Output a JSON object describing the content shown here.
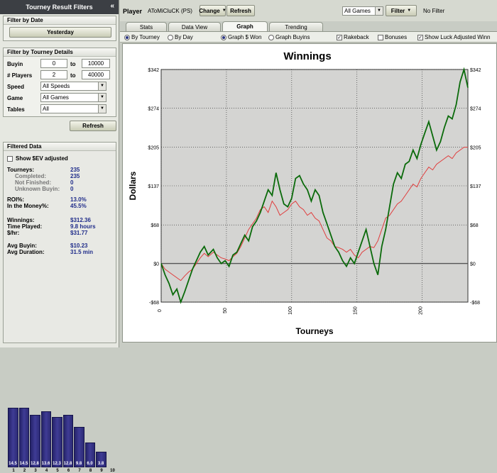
{
  "left": {
    "title": "Tourney Result Filters",
    "collapse_glyph": "«",
    "by_date": {
      "header": "Filter by Date",
      "button": "Yesterday"
    },
    "details": {
      "header": "Filter by Tourney Details",
      "buyin_label": "Buyin",
      "buyin_min": "0",
      "buyin_to": "to",
      "buyin_max": "10000",
      "players_label": "# Players",
      "players_min": "2",
      "players_to": "to",
      "players_max": "40000",
      "speed_label": "Speed",
      "speed_value": "All Speeds",
      "game_label": "Game",
      "game_value": "All Games",
      "tables_label": "Tables",
      "tables_value": "All"
    },
    "refresh": "Refresh",
    "filtered": {
      "header": "Filtered Data",
      "show_ev": "Show $EV adjusted",
      "stats": [
        {
          "label": "Tourneys:",
          "value": "235",
          "sub": false
        },
        {
          "label": "Completed:",
          "value": "235",
          "sub": true
        },
        {
          "label": "Not Finished:",
          "value": "0",
          "sub": true
        },
        {
          "label": "Unknown Buyin:",
          "value": "0",
          "sub": true
        },
        {
          "label": "ROI%:",
          "value": "13.0%",
          "sub": false
        },
        {
          "label": "In the Money%:",
          "value": "45.5%",
          "sub": false
        },
        {
          "label": "Winnings:",
          "value": "$312.36",
          "sub": false
        },
        {
          "label": "Time Played:",
          "value": "9.8 hours",
          "sub": false
        },
        {
          "label": "$/hr:",
          "value": "$31.77",
          "sub": false
        },
        {
          "label": "Avg Buyin:",
          "value": "$10.23",
          "sub": false
        },
        {
          "label": "Avg Duration:",
          "value": "31.5 min",
          "sub": false
        }
      ],
      "histogram": {
        "values": [
          14.5,
          14.5,
          12.8,
          13.6,
          12.3,
          12.8,
          9.8,
          6.0,
          3.8
        ],
        "labels": [
          "14.5",
          "14.5",
          "12.8",
          "13.6",
          "12.3",
          "12.8",
          "9.8",
          "6.0",
          "3.8"
        ],
        "bins": [
          "1",
          "2",
          "3",
          "4",
          "5",
          "6",
          "7",
          "8",
          "9",
          "10"
        ],
        "bar_color": "#3a3790"
      }
    }
  },
  "top": {
    "player_label": "Player",
    "player_value": "AToMiCluCK (PS)",
    "change": "Change",
    "refresh": "Refresh",
    "games_value": "All Games",
    "filter": "Filter",
    "no_filter": "No Filter"
  },
  "tabs": [
    "Stats",
    "Data View",
    "Graph",
    "Trending"
  ],
  "active_tab": "Graph",
  "options": {
    "by_tourney": "By Tourney",
    "by_day": "By Day",
    "graph_won": "Graph $ Won",
    "graph_buyins": "Graph Buyins",
    "rakeback": "Rakeback",
    "bonuses": "Bonuses",
    "luck": "Show Luck Adjusted Winn"
  },
  "chart_data": {
    "type": "line",
    "title": "Winnings",
    "xlabel": "Tourneys",
    "ylabel": "Dollars",
    "xlim": [
      0,
      235
    ],
    "ylim": [
      -68,
      342
    ],
    "yticks": [
      "-$68",
      "$0",
      "$68",
      "$137",
      "$205",
      "$274",
      "$342"
    ],
    "ytick_values": [
      -68,
      0,
      68,
      137,
      205,
      274,
      342
    ],
    "xticks": [
      "0",
      "50",
      "100",
      "150",
      "200"
    ],
    "xtick_values": [
      0,
      50,
      100,
      150,
      200
    ],
    "grid": true,
    "series": [
      {
        "color": "#0a6a0a",
        "x": [
          0,
          3,
          6,
          9,
          12,
          15,
          18,
          21,
          24,
          27,
          30,
          33,
          36,
          40,
          43,
          46,
          49,
          52,
          55,
          58,
          61,
          64,
          67,
          70,
          73,
          76,
          79,
          82,
          85,
          88,
          91,
          94,
          97,
          100,
          103,
          106,
          109,
          112,
          115,
          118,
          121,
          124,
          127,
          130,
          133,
          136,
          139,
          142,
          145,
          148,
          151,
          154,
          157,
          160,
          163,
          166,
          169,
          172,
          175,
          178,
          181,
          184,
          187,
          190,
          193,
          196,
          199,
          202,
          205,
          208,
          211,
          214,
          217,
          220,
          223,
          226,
          229,
          232,
          235
        ],
        "y": [
          0,
          -20,
          -35,
          -55,
          -45,
          -68,
          -50,
          -30,
          -10,
          5,
          20,
          30,
          15,
          25,
          10,
          0,
          5,
          -5,
          15,
          20,
          35,
          50,
          40,
          65,
          75,
          90,
          110,
          130,
          120,
          160,
          130,
          105,
          100,
          115,
          150,
          155,
          140,
          130,
          110,
          130,
          120,
          90,
          70,
          50,
          30,
          20,
          5,
          -5,
          10,
          0,
          20,
          40,
          60,
          30,
          0,
          -20,
          30,
          60,
          100,
          140,
          160,
          150,
          175,
          180,
          200,
          185,
          210,
          230,
          250,
          225,
          200,
          215,
          240,
          260,
          255,
          280,
          320,
          342,
          310
        ]
      },
      {
        "color": "#e03c3c",
        "x": [
          0,
          3,
          6,
          9,
          12,
          15,
          18,
          21,
          24,
          27,
          30,
          33,
          36,
          40,
          43,
          46,
          49,
          52,
          55,
          58,
          61,
          64,
          67,
          70,
          73,
          76,
          79,
          82,
          85,
          88,
          91,
          94,
          97,
          100,
          103,
          106,
          109,
          112,
          115,
          118,
          121,
          124,
          127,
          130,
          133,
          136,
          139,
          142,
          145,
          148,
          151,
          154,
          157,
          160,
          163,
          166,
          169,
          172,
          175,
          178,
          181,
          184,
          187,
          190,
          193,
          196,
          199,
          202,
          205,
          208,
          211,
          214,
          217,
          220,
          223,
          226,
          229,
          232,
          235
        ],
        "y": [
          0,
          -10,
          -15,
          -20,
          -25,
          -30,
          -22,
          -15,
          -10,
          0,
          10,
          18,
          12,
          20,
          15,
          10,
          8,
          5,
          12,
          18,
          30,
          45,
          60,
          70,
          80,
          95,
          100,
          90,
          110,
          100,
          85,
          90,
          95,
          105,
          110,
          100,
          95,
          85,
          90,
          80,
          75,
          60,
          45,
          40,
          30,
          28,
          25,
          20,
          25,
          15,
          10,
          20,
          25,
          30,
          28,
          40,
          60,
          80,
          85,
          95,
          105,
          110,
          120,
          130,
          140,
          135,
          150,
          160,
          170,
          165,
          175,
          180,
          185,
          190,
          185,
          195,
          200,
          205,
          205
        ]
      }
    ]
  }
}
